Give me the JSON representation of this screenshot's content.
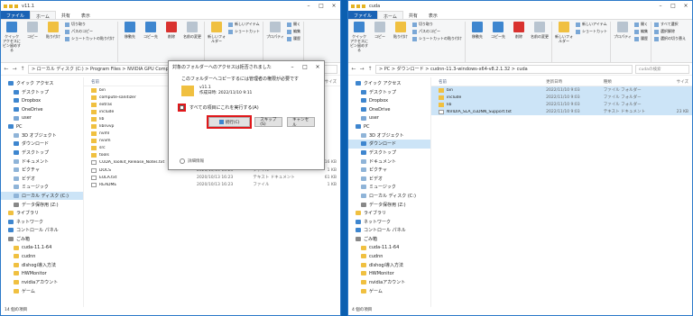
{
  "left": {
    "title": "v11.1",
    "tabs": [
      "ファイル",
      "ホーム",
      "共有",
      "表示"
    ],
    "ribbon": {
      "pin": "クイック アクセスにピン留めする",
      "copy": "コピー",
      "paste": "貼り付け",
      "cut": "切り取り",
      "copy_path": "パスのコピー",
      "paste_shortcut": "ショートカットの貼り付け",
      "move_to": "移動先",
      "copy_to": "コピー先",
      "delete": "削除",
      "rename": "名前の変更",
      "new_folder": "新しいフォルダー",
      "new_item": "新しいアイテム",
      "easy_access": "ショートカット",
      "properties": "プロパティ",
      "open": "開く",
      "edit": "編集",
      "history": "履歴",
      "select_all": "すべて選択",
      "select_none": "選択解除",
      "invert": "選択の切り替え"
    },
    "path": "> ローカル ディスク (C:) > Program Files > NVIDIA GPU Comp",
    "columns": [
      "名前",
      "更新日時",
      "種類",
      "サイズ"
    ],
    "nav": [
      "クイック アクセス",
      "デスクトップ",
      "Dropbox",
      "OneDrive",
      "user",
      "PC",
      "3D オブジェクト",
      "ダウンロード",
      "デスクトップ",
      "ドキュメント",
      "ピクチャ",
      "ビデオ",
      "ミュージック",
      "ローカル ディスク (C:)",
      "データ保存用 (Z:)",
      "ライブラリ",
      "ネットワーク",
      "コントロール パネル",
      "ごみ箱",
      "cuda-11.1-64",
      "cudnn",
      "dlshogi導入方法",
      "HWMonitor",
      "nvidiaアカウント",
      "ゲーム"
    ],
    "files": [
      {
        "name": "bin",
        "date": "",
        "type": "",
        "size": ""
      },
      {
        "name": "compute-sanitizer",
        "date": "",
        "type": "",
        "size": ""
      },
      {
        "name": "extras",
        "date": "",
        "type": "",
        "size": ""
      },
      {
        "name": "include",
        "date": "",
        "type": "",
        "size": ""
      },
      {
        "name": "lib",
        "date": "",
        "type": "",
        "size": ""
      },
      {
        "name": "libnvvp",
        "date": "",
        "type": "",
        "size": ""
      },
      {
        "name": "nvml",
        "date": "",
        "type": "",
        "size": ""
      },
      {
        "name": "nvvm",
        "date": "",
        "type": "",
        "size": ""
      },
      {
        "name": "src",
        "date": "",
        "type": "",
        "size": ""
      },
      {
        "name": "tools",
        "date": "2022/11/10 9:11",
        "type": "ファイル フォルダー",
        "size": ""
      },
      {
        "name": "CUDA_Toolkit_Release_Notes.txt",
        "date": "2020/10/13 16:23",
        "type": "テキスト ドキュメント",
        "size": "16 KB"
      },
      {
        "name": "DOCS",
        "date": "2020/10/13 16:23",
        "type": "ファイル",
        "size": "1 KB"
      },
      {
        "name": "EULA.txt",
        "date": "2020/10/13 16:23",
        "type": "テキスト ドキュメント",
        "size": "61 KB"
      },
      {
        "name": "README",
        "date": "2020/10/13 16:23",
        "type": "ファイル",
        "size": "1 KB"
      }
    ],
    "status": "14 個の項目"
  },
  "right": {
    "title": "cuda",
    "tabs": [
      "ファイル",
      "ホーム",
      "共有",
      "表示"
    ],
    "path": "> PC > ダウンロード > cudnn-11.3-windows-x64-v8.2.1.32 > cuda",
    "search": "cudaの検索",
    "columns": [
      "名前",
      "更新日時",
      "種類",
      "サイズ"
    ],
    "nav": [
      "クイック アクセス",
      "デスクトップ",
      "Dropbox",
      "OneDrive",
      "user",
      "PC",
      "3D オブジェクト",
      "ダウンロード",
      "デスクトップ",
      "ドキュメント",
      "ピクチャ",
      "ビデオ",
      "ミュージック",
      "ローカル ディスク (C:)",
      "データ保存用 (Z:)",
      "ライブラリ",
      "ネットワーク",
      "コントロール パネル",
      "ごみ箱",
      "cuda-11.1-64",
      "cudnn",
      "dlshogi導入方法",
      "HWMonitor",
      "nvidiaアカウント",
      "ゲーム"
    ],
    "files": [
      {
        "name": "bin",
        "date": "2022/11/10 9:03",
        "type": "ファイル フォルダー",
        "size": ""
      },
      {
        "name": "include",
        "date": "2022/11/10 9:03",
        "type": "ファイル フォルダー",
        "size": ""
      },
      {
        "name": "lib",
        "date": "2022/11/10 9:03",
        "type": "ファイル フォルダー",
        "size": ""
      },
      {
        "name": "NVIDIA_SLA_cuDNN_Support.txt",
        "date": "2022/11/10 9:03",
        "type": "テキスト ドキュメント",
        "size": "23 KB"
      }
    ],
    "status": "4 個の項目"
  },
  "dialog": {
    "title": "対象のフォルダーへのアクセスは拒否されました",
    "message": "このフォルダーへコピーするには管理者の権限が必要です",
    "folder_name": "v11.1",
    "folder_date": "作成日時: 2022/11/10 9:11",
    "checkbox_label": "すべての項目にこれを実行する(A)",
    "retry": "続行(C)",
    "skip": "スキップ(S)",
    "cancel": "キャンセル",
    "details": "詳細情報"
  }
}
